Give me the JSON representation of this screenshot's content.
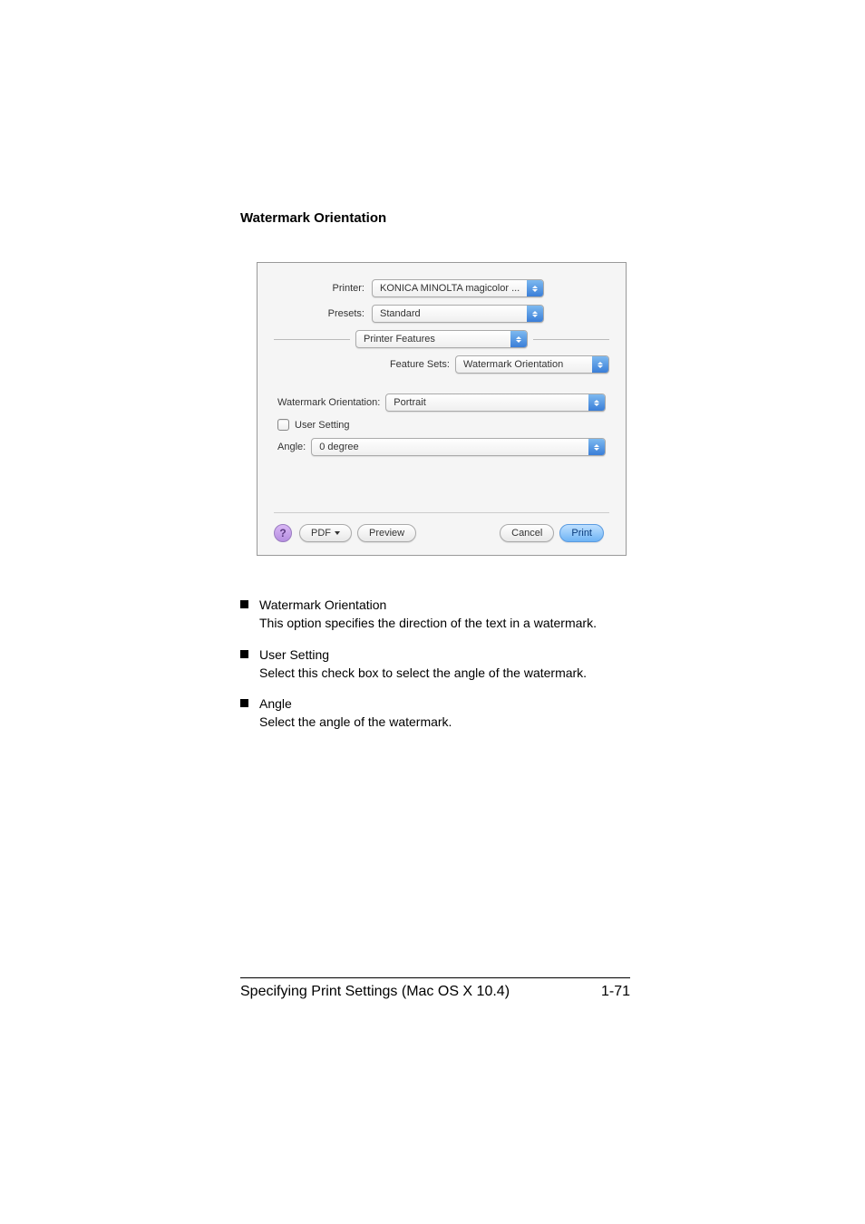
{
  "section_heading": "Watermark Orientation",
  "dialog": {
    "printer_label": "Printer:",
    "printer_value": "KONICA MINOLTA magicolor ...",
    "presets_label": "Presets:",
    "presets_value": "Standard",
    "pane_value": "Printer Features",
    "feature_sets_label": "Feature Sets:",
    "feature_sets_value": "Watermark Orientation",
    "watermark_orientation_label": "Watermark Orientation:",
    "watermark_orientation_value": "Portrait",
    "user_setting_label": "User Setting",
    "angle_label": "Angle:",
    "angle_value": "0 degree",
    "help_glyph": "?",
    "pdf_btn": "PDF",
    "preview_btn": "Preview",
    "cancel_btn": "Cancel",
    "print_btn": "Print"
  },
  "bullets": [
    {
      "title": "Watermark Orientation",
      "desc": "This option specifies the direction of the text in a watermark."
    },
    {
      "title": "User Setting",
      "desc": "Select this check box to select the angle of the watermark."
    },
    {
      "title": "Angle",
      "desc": "Select the angle of the watermark."
    }
  ],
  "footer": {
    "left": "Specifying Print Settings (Mac OS X 10.4)",
    "right": "1-71"
  }
}
